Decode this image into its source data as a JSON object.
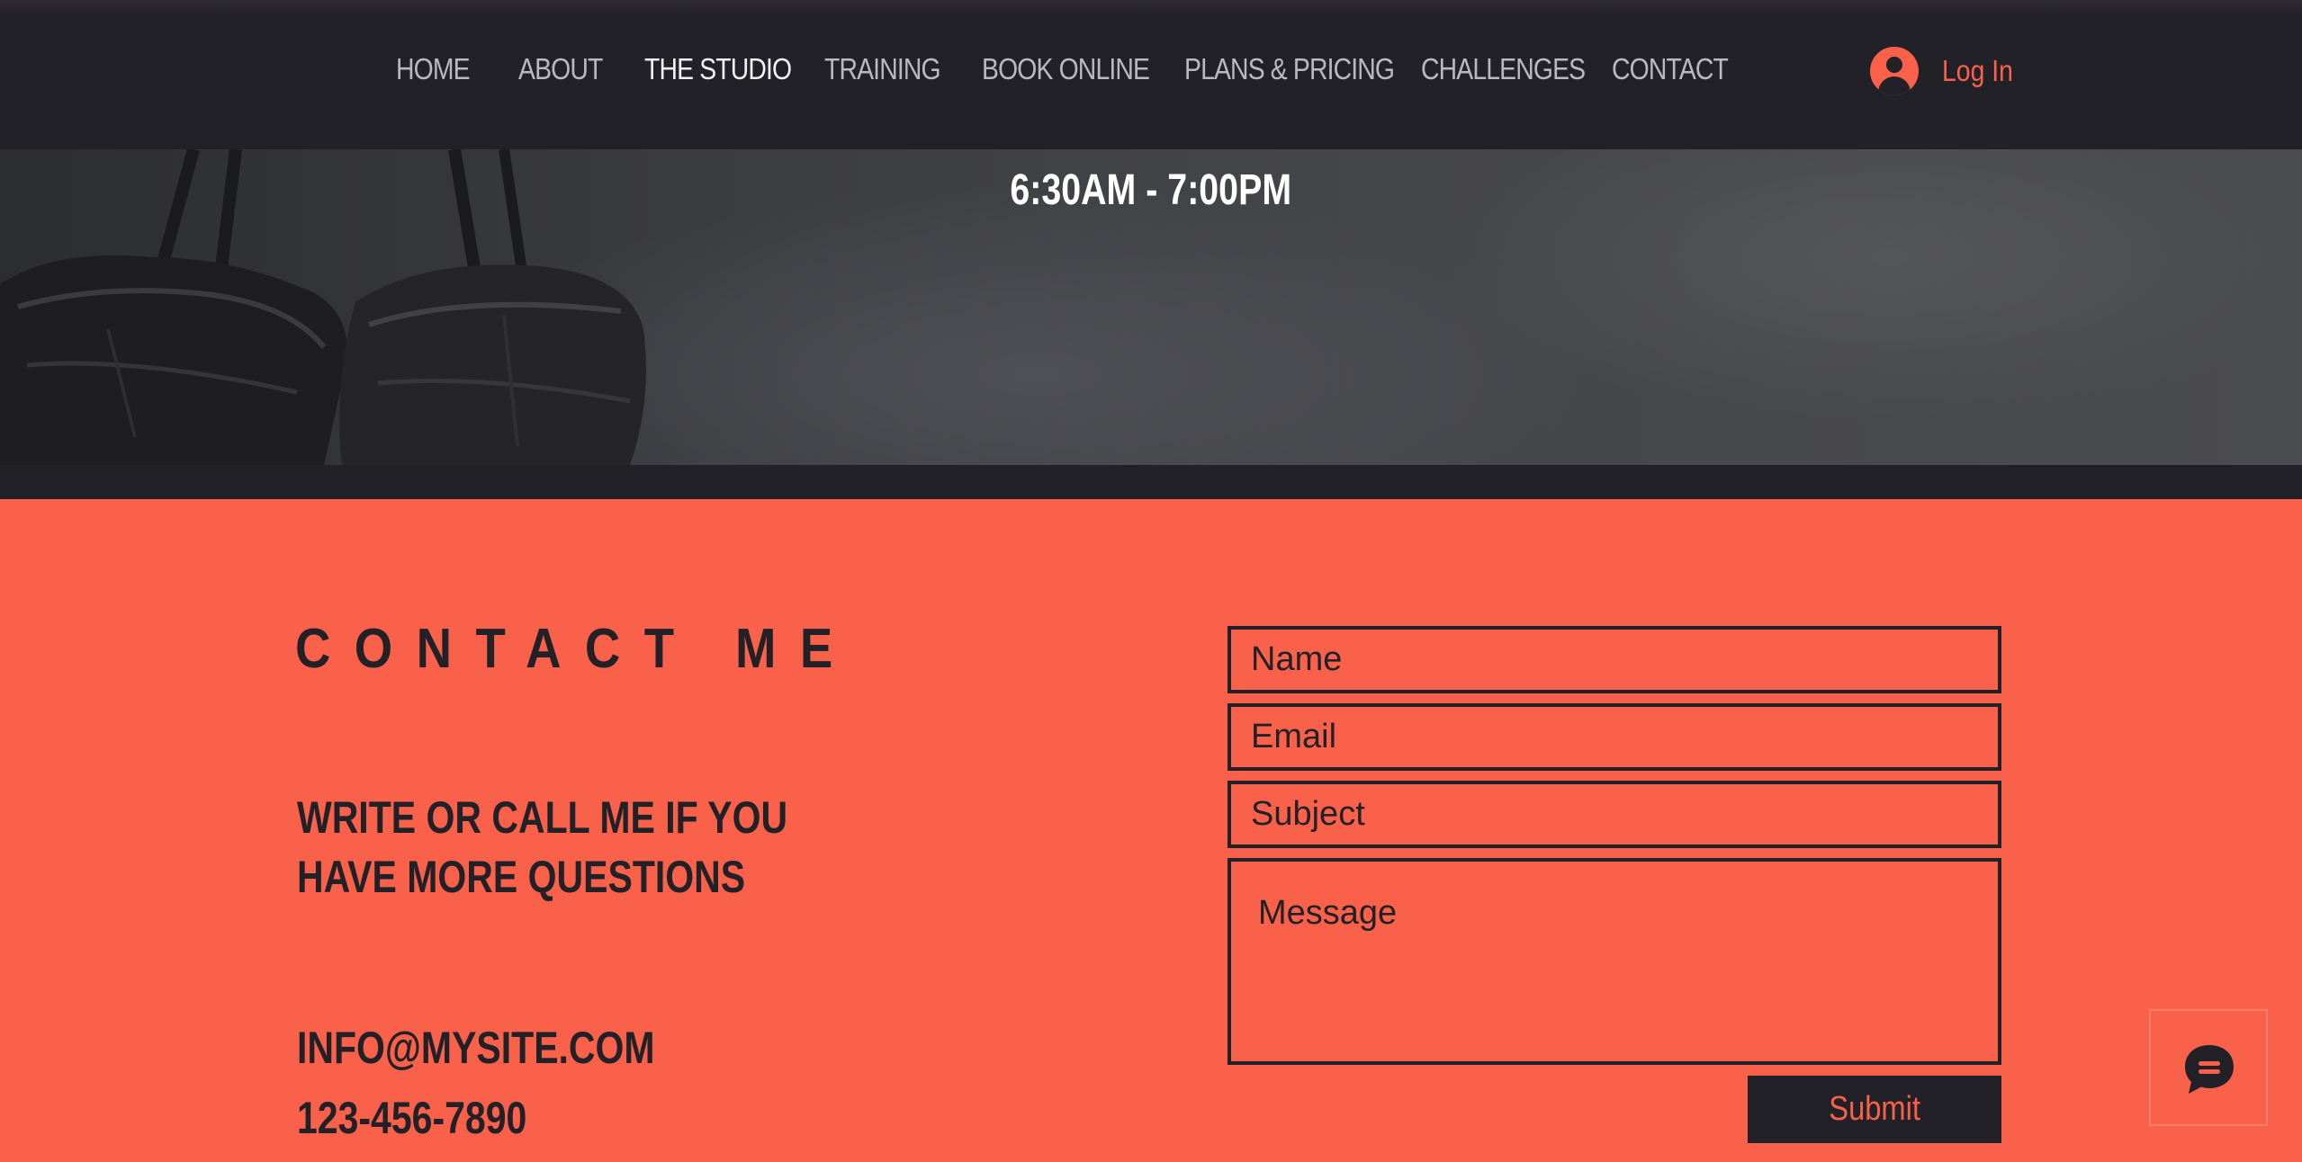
{
  "nav": {
    "items": [
      {
        "label": "HOME"
      },
      {
        "label": "ABOUT"
      },
      {
        "label": "THE STUDIO"
      },
      {
        "label": "TRAINING"
      },
      {
        "label": "BOOK ONLINE"
      },
      {
        "label": "PLANS & PRICING"
      },
      {
        "label": "CHALLENGES"
      },
      {
        "label": "CONTACT"
      }
    ],
    "active": "THE STUDIO",
    "login_label": "Log In"
  },
  "hero": {
    "hours": "6:30AM - 7:00PM"
  },
  "contact": {
    "title": "CONTACT ME",
    "subtitle_line1": "WRITE OR CALL ME IF YOU",
    "subtitle_line2": "HAVE MORE QUESTIONS",
    "email": "INFO@MYSITE.COM",
    "phone": "123-456-7890"
  },
  "form": {
    "name_placeholder": "Name",
    "email_placeholder": "Email",
    "subject_placeholder": "Subject",
    "message_placeholder": "Message",
    "submit_label": "Submit"
  },
  "colors": {
    "accent": "#f9614b",
    "dark": "#222127",
    "nav_text": "#b9b9bf"
  },
  "icons": {
    "login": "user-avatar-icon",
    "chat": "chat-bubble-icon"
  }
}
